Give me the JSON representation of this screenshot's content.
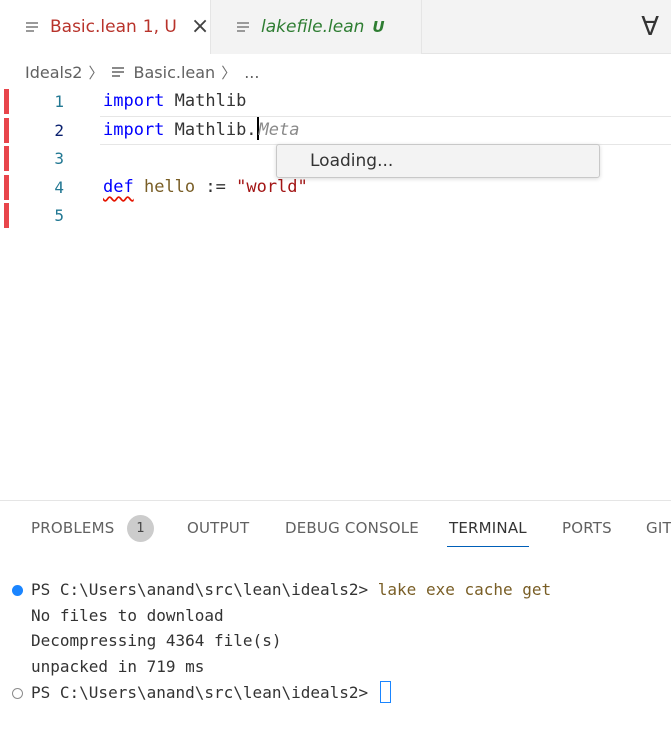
{
  "tabs": [
    {
      "label": "Basic.lean",
      "status": "1, U",
      "active": true
    },
    {
      "label": "lakefile.lean",
      "status": "U",
      "active": false
    }
  ],
  "toolbar": {
    "forall_glyph": "∀",
    "icon": "lean-infoview-icon"
  },
  "breadcrumb": {
    "folder": "Ideals2",
    "file": "Basic.lean",
    "more": "..."
  },
  "editor": {
    "lines": [
      {
        "num": "1",
        "kw": "import",
        "rest": " Mathlib"
      },
      {
        "num": "2",
        "kw": "import",
        "rest": " Mathlib.",
        "ghost": "Meta"
      },
      {
        "num": "3"
      },
      {
        "num": "4",
        "kw": "def",
        "space1": " ",
        "fn": "hello",
        "op": " := ",
        "str": "\"world\""
      },
      {
        "num": "5"
      }
    ],
    "suggest": "Loading..."
  },
  "panel": {
    "tabs": [
      "PROBLEMS",
      "OUTPUT",
      "DEBUG CONSOLE",
      "TERMINAL",
      "PORTS",
      "GIT"
    ],
    "problems_count": "1",
    "active_tab": "TERMINAL"
  },
  "terminal": {
    "prompt": "PS C:\\Users\\anand\\src\\lean\\ideals2> ",
    "command": "lake exe cache get",
    "output": [
      "No files to download",
      "Decompressing 4364 file(s)",
      "unpacked in 719 ms"
    ],
    "prompt2": "PS C:\\Users\\anand\\src\\lean\\ideals2> "
  },
  "colors": {
    "accent": "#005fb8",
    "error": "#e8454b",
    "keyword": "#0000ff",
    "string": "#a31515"
  }
}
